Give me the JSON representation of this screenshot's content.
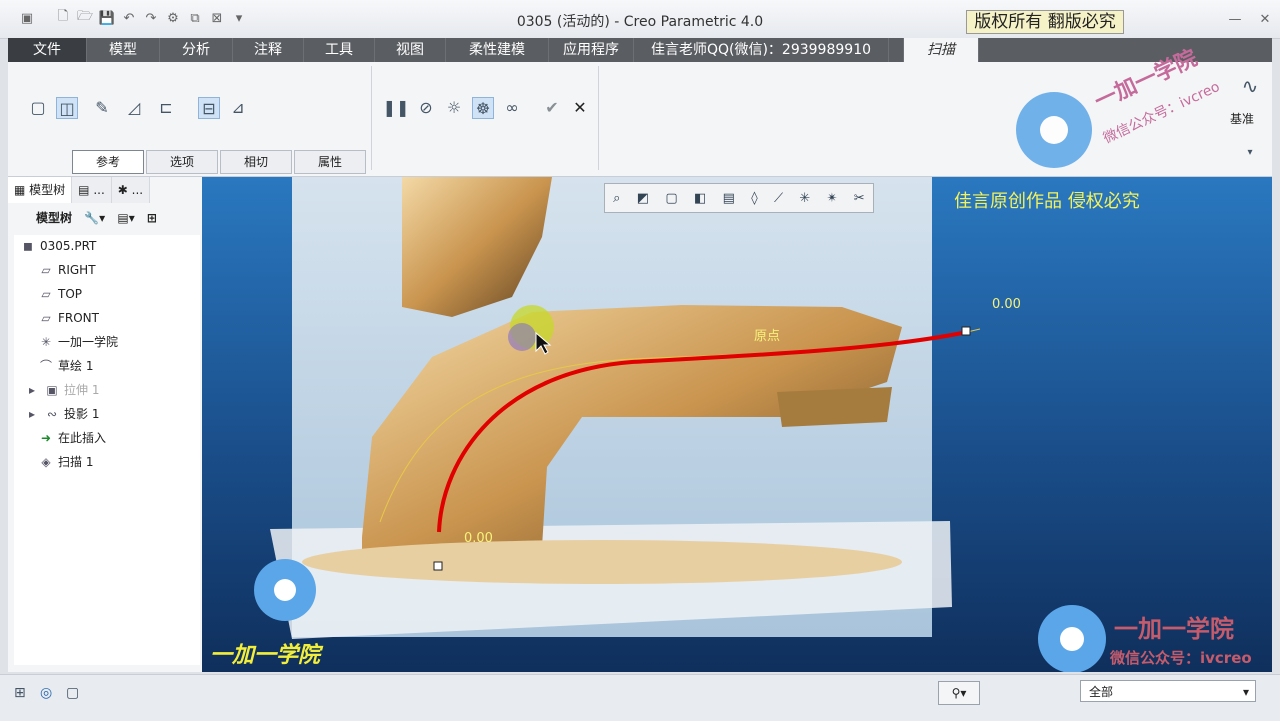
{
  "window": {
    "title": "0305 (活动的) - Creo Parametric 4.0",
    "stamp": "版权所有 翻版必究"
  },
  "tabs": [
    {
      "label": "文件"
    },
    {
      "label": "模型"
    },
    {
      "label": "分析"
    },
    {
      "label": "注释"
    },
    {
      "label": "工具"
    },
    {
      "label": "视图"
    },
    {
      "label": "柔性建模"
    },
    {
      "label": "应用程序"
    },
    {
      "label": "佳言老师QQ(微信)：2939989910"
    },
    {
      "label": "扫描"
    }
  ],
  "ribbon": {
    "subtabs": [
      "参考",
      "选项",
      "相切",
      "属性"
    ],
    "datum_label": "基准"
  },
  "left_panel": {
    "tabs": [
      "模型树",
      "...",
      "..."
    ],
    "header": "模型树"
  },
  "tree": [
    {
      "label": "0305.PRT",
      "icon": "part-icon"
    },
    {
      "label": "RIGHT",
      "icon": "plane-icon"
    },
    {
      "label": "TOP",
      "icon": "plane-icon"
    },
    {
      "label": "FRONT",
      "icon": "plane-icon"
    },
    {
      "label": "一加一学院",
      "icon": "csys-icon"
    },
    {
      "label": "草绘 1",
      "icon": "sketch-icon"
    },
    {
      "label": "拉伸 1",
      "icon": "extrude-icon"
    },
    {
      "label": "投影 1",
      "icon": "projection-icon"
    },
    {
      "label": "在此插入",
      "icon": "insert-arrow-icon"
    },
    {
      "label": "扫描 1",
      "icon": "sweep-icon"
    }
  ],
  "viewport": {
    "watermark_top": "佳言原创作品 侵权必究",
    "label_origin": "原点",
    "label_end": "0.00",
    "label_start": "0.00",
    "brand_left": "一加一学院",
    "brand_right": "一加一学院",
    "brand_right_sub": "微信公众号：ivcreo",
    "brand_top": "一加一学院",
    "brand_top_sub": "微信公众号：ivcreo"
  },
  "status": {
    "filter_value": "全部"
  }
}
